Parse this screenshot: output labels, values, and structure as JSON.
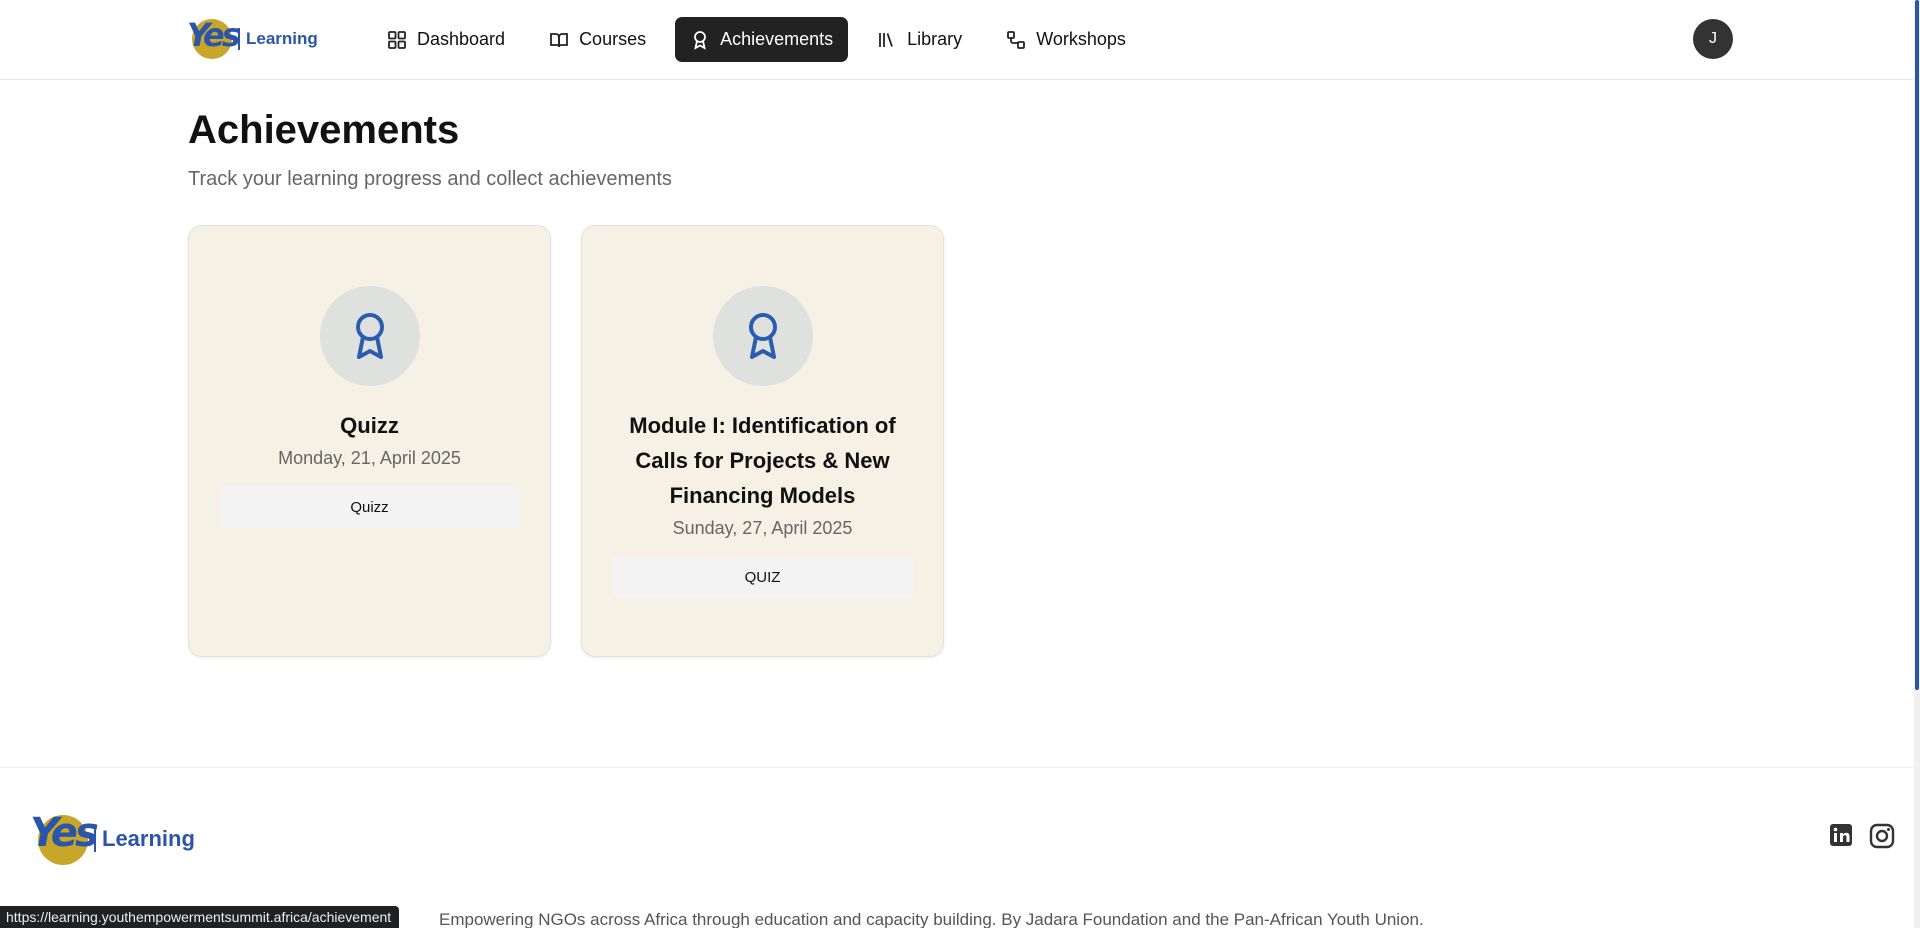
{
  "header": {
    "logo_text": "Learning",
    "logo_mark": "Yes",
    "nav": [
      {
        "label": "Dashboard",
        "icon": "grid-icon",
        "active": false
      },
      {
        "label": "Courses",
        "icon": "book-icon",
        "active": false
      },
      {
        "label": "Achievements",
        "icon": "award-icon",
        "active": true
      },
      {
        "label": "Library",
        "icon": "library-icon",
        "active": false
      },
      {
        "label": "Workshops",
        "icon": "workflow-icon",
        "active": false
      }
    ],
    "avatar_initial": "J"
  },
  "main": {
    "title": "Achievements",
    "subtitle": "Track your learning progress and collect achievements",
    "cards": [
      {
        "title": "Quizz",
        "date": "Monday, 21, April 2025",
        "tag": "Quizz",
        "icon": "award-icon"
      },
      {
        "title": "Module I: Identification of Calls for Projects & New Financing Models",
        "date": "Sunday, 27, April 2025",
        "tag": "QUIZ",
        "icon": "award-icon"
      }
    ]
  },
  "footer": {
    "logo_text": "Learning",
    "logo_mark": "Yes",
    "description": "Empowering NGOs across Africa through education and capacity building. By Jadara Foundation and the Pan-African Youth Union.",
    "social": [
      "linkedin-icon",
      "instagram-icon"
    ]
  },
  "status_bar": {
    "url": "https://learning.youthempowermentsummit.africa/achievement"
  },
  "colors": {
    "brand_blue": "#2a55a8",
    "brand_gold": "#c8a62a",
    "nav_active_bg": "#222222",
    "card_bg": "#f5f1e5"
  }
}
